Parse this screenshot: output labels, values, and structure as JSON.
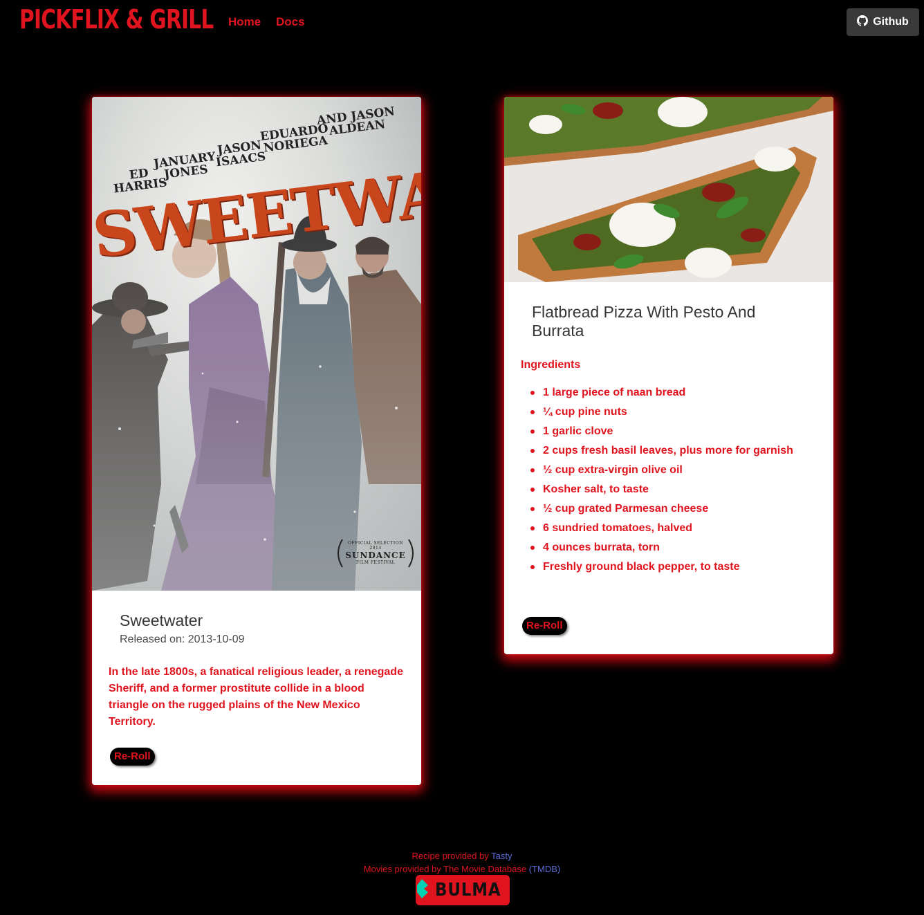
{
  "navbar": {
    "brand": "PICKFLIX & GRILL",
    "links": [
      {
        "label": "Home"
      },
      {
        "label": "Docs"
      }
    ],
    "github_label": "Github"
  },
  "movie": {
    "poster": {
      "title": "SWEETWATER",
      "credits": [
        {
          "first": "ED",
          "last": "HARRIS"
        },
        {
          "first": "JANUARY",
          "last": "JONES"
        },
        {
          "first": "JASON",
          "last": "ISAACS"
        },
        {
          "first": "EDUARDO",
          "last": "NORIEGA"
        },
        {
          "first": "AND JASON",
          "last": "ALDEAN"
        }
      ],
      "laurel": {
        "line1": "OFFICIAL SELECTION",
        "year": "2013",
        "festival": "SUNDANCE",
        "line3": "FILM FESTIVAL"
      }
    },
    "title": "Sweetwater",
    "release": "Released on: 2013-10-09",
    "overview": "In the late 1800s, a fanatical religious leader, a renegade Sheriff, and a former prostitute collide in a blood triangle on the rugged plains of the New Mexico Territory.",
    "reroll_label": "Re-Roll"
  },
  "recipe": {
    "title": "Flatbread Pizza With Pesto And Burrata",
    "ingredients_heading": "Ingredients",
    "ingredients": [
      "1 large piece of naan bread",
      "¼ cup pine nuts",
      "1 garlic clove",
      "2 cups fresh basil leaves, plus more for garnish",
      "½ cup extra-virgin olive oil",
      "Kosher salt, to taste",
      "½ cup grated Parmesan cheese",
      "6 sundried tomatoes, halved",
      "4 ounces burrata, torn",
      "Freshly ground black pepper, to taste"
    ],
    "reroll_label": "Re-Roll"
  },
  "footer": {
    "recipe_prefix": "Recipe provided by ",
    "recipe_link": "Tasty",
    "movies_prefix": "Movies provided by The Movie Database ",
    "movies_link": "(TMDB)",
    "badge_text": "BULMA"
  },
  "colors": {
    "accent": "#e0141e",
    "background": "#000000",
    "link": "#5b6cd6"
  }
}
